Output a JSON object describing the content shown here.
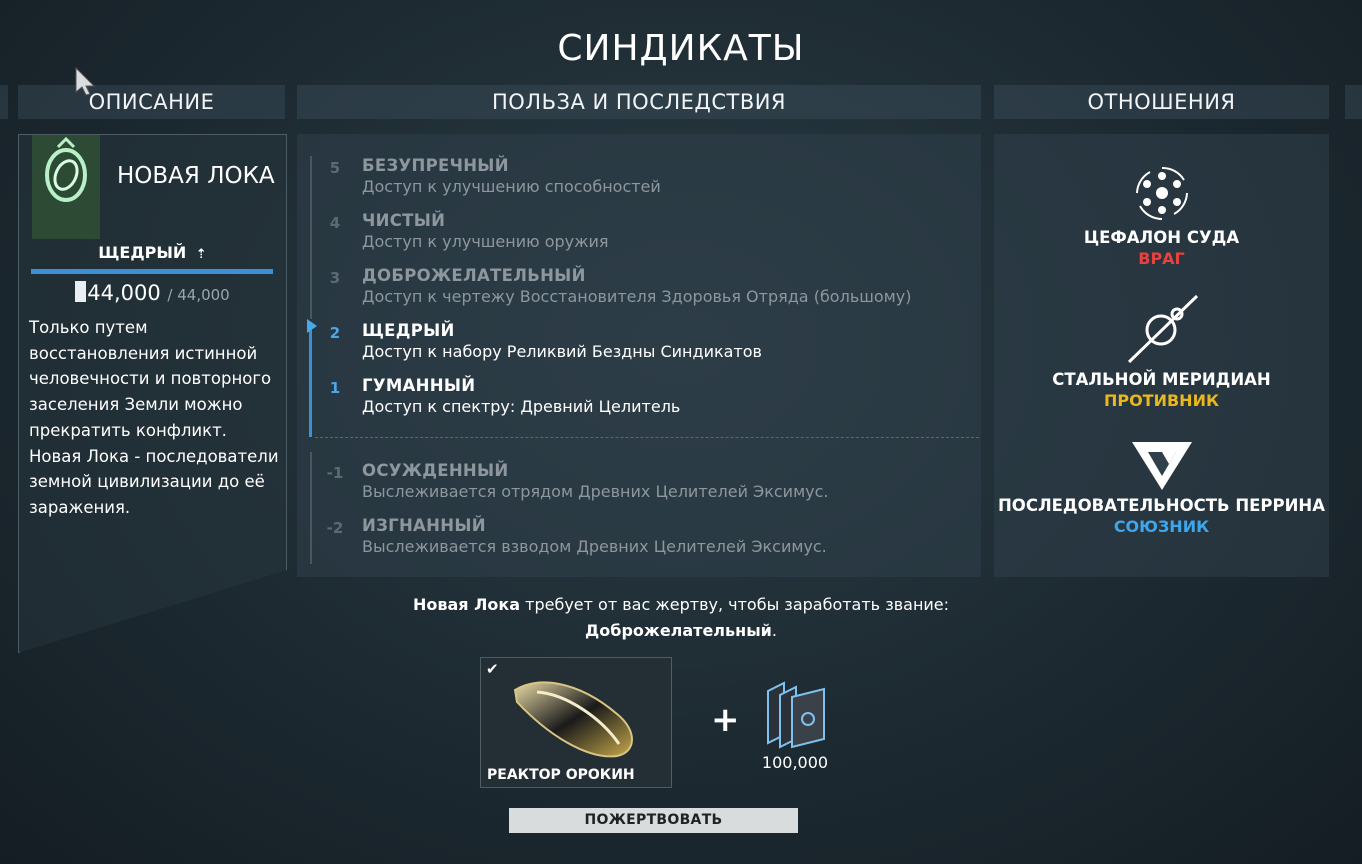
{
  "page_title": "СИНДИКАТЫ",
  "columns": {
    "description": "ОПИСАНИЕ",
    "benefits": "ПОЛЬЗА И ПОСЛЕДСТВИЯ",
    "relations": "ОТНОШЕНИЯ"
  },
  "syndicate": {
    "name": "НОВАЯ ЛОКА",
    "rank": "ЩЕДРЫЙ",
    "rank_up_icon": "rank-up-icon",
    "standing": "44,000",
    "standing_max": "/ 44,000",
    "standing_progress": 1.0,
    "description": "Только путем восстановления истинной человечности и повторного заселения Земли можно прекратить конфликт. Новая Лока - последователи земной цивилизации до её заражения."
  },
  "ranks": [
    {
      "num": "5",
      "name": "БЕЗУПРЕЧНЫЙ",
      "benefit": "Доступ к улучшению способностей",
      "state": "locked"
    },
    {
      "num": "4",
      "name": "ЧИСТЫЙ",
      "benefit": "Доступ к улучшению оружия",
      "state": "locked"
    },
    {
      "num": "3",
      "name": "ДОБРОЖЕЛАТЕЛЬНЫЙ",
      "benefit": "Доступ к чертежу Восстановителя Здоровья Отряда (большому)",
      "state": "locked"
    },
    {
      "num": "2",
      "name": "ЩЕДРЫЙ",
      "benefit": "Доступ к набору Реликвий Бездны Синдикатов",
      "state": "current"
    },
    {
      "num": "1",
      "name": "ГУМАННЫЙ",
      "benefit": "Доступ к спектру: Древний Целитель",
      "state": "achieved"
    },
    {
      "num": "-1",
      "name": "ОСУЖДЕННЫЙ",
      "benefit": "Выслеживается отрядом Древних Целителей Эксимус.",
      "state": "negative"
    },
    {
      "num": "-2",
      "name": "ИЗГНАННЫЙ",
      "benefit": "Выслеживается взводом Древних Целителей Эксимус.",
      "state": "negative"
    }
  ],
  "relations": [
    {
      "name": "ЦЕФАЛОН СУДА",
      "status": "ВРАГ",
      "color": "#e8423e",
      "icon": "cephalon-suda-icon"
    },
    {
      "name": "СТАЛЬНОЙ МЕРИДИАН",
      "status": "ПРОТИВНИК",
      "color": "#e8b81c",
      "icon": "steel-meridian-icon"
    },
    {
      "name": "ПОСЛЕДОВАТЕЛЬНОСТЬ ПЕРРИНА",
      "status": "СОЮЗНИК",
      "color": "#3ea6ea",
      "icon": "perrin-sequence-icon"
    }
  ],
  "sacrifice": {
    "syndicate": "Новая Лока",
    "text": " требует от вас жертву, чтобы заработать звание:",
    "rank": "Доброжелательный",
    "period": ".",
    "item_label": "РЕАКТОР ОРОКИН",
    "credits": "100,000",
    "plus": "+"
  },
  "donate_label": "ПОЖЕРТВОВАТЬ",
  "colors": {
    "accent": "#3d8fd6",
    "panel": "#30404a"
  }
}
